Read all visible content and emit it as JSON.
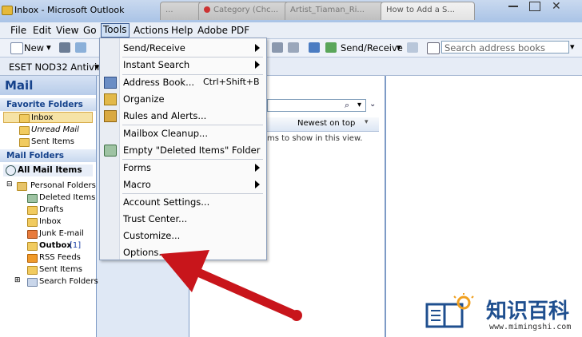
{
  "window": {
    "title": "Inbox - Microsoft Outlook",
    "bg_tabs": [
      "...",
      "Category (Chc...",
      "Artist_Tiaman_Ri...",
      "How to Add a S..."
    ]
  },
  "menubar": {
    "items": [
      "File",
      "Edit",
      "View",
      "Go",
      "Tools",
      "Actions",
      "Help",
      "Adobe PDF"
    ]
  },
  "toolbar": {
    "new_label": "New",
    "send_receive_label": "Send/Receive",
    "search_placeholder": "Search address books"
  },
  "toolbar2": {
    "eset_label": "ESET NOD32 Antivirus"
  },
  "nav": {
    "title": "Mail",
    "favorite_header": "Favorite Folders",
    "favorites": [
      "Inbox",
      "Unread Mail",
      "Sent Items"
    ],
    "mail_folders_header": "Mail Folders",
    "all_mail_items": "All Mail Items",
    "personal_folders": "Personal Folders",
    "folders": [
      {
        "name": "Deleted Items",
        "count": ""
      },
      {
        "name": "Drafts",
        "count": ""
      },
      {
        "name": "Inbox",
        "count": ""
      },
      {
        "name": "Junk E-mail",
        "count": ""
      },
      {
        "name": "Outbox",
        "count": "[1]"
      },
      {
        "name": "RSS Feeds",
        "count": ""
      },
      {
        "name": "Sent Items",
        "count": ""
      },
      {
        "name": "Search Folders",
        "count": ""
      }
    ]
  },
  "midpanel": {
    "arrange_label": "Newest on top",
    "empty_text": "ms to show in this view."
  },
  "tools_menu": {
    "items": [
      {
        "label": "Send/Receive",
        "shortcut": "",
        "submenu": true
      },
      {
        "label": "Instant Search",
        "shortcut": "",
        "submenu": true
      },
      {
        "label": "Address Book...",
        "shortcut": "Ctrl+Shift+B",
        "submenu": false
      },
      {
        "label": "Organize",
        "shortcut": "",
        "submenu": false
      },
      {
        "label": "Rules and Alerts...",
        "shortcut": "",
        "submenu": false
      },
      {
        "label": "Mailbox Cleanup...",
        "shortcut": "",
        "submenu": false
      },
      {
        "label": "Empty \"Deleted Items\" Folder",
        "shortcut": "",
        "submenu": false
      },
      {
        "label": "Forms",
        "shortcut": "",
        "submenu": true
      },
      {
        "label": "Macro",
        "shortcut": "",
        "submenu": true
      },
      {
        "label": "Account Settings...",
        "shortcut": "",
        "submenu": false
      },
      {
        "label": "Trust Center...",
        "shortcut": "",
        "submenu": false
      },
      {
        "label": "Customize...",
        "shortcut": "",
        "submenu": false
      },
      {
        "label": "Options...",
        "shortcut": "",
        "submenu": false
      }
    ]
  },
  "watermark": {
    "brand": "知识百科",
    "url": "www.mimingshi.com"
  },
  "colors": {
    "arrow": "#c8151b",
    "accent": "#15428b"
  }
}
